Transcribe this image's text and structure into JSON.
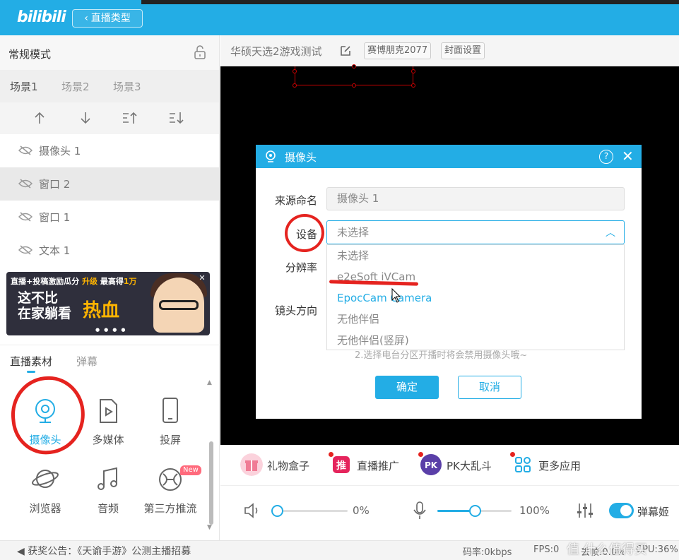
{
  "header": {
    "logo": "bilibili",
    "back_label": "直播类型"
  },
  "left": {
    "mode_label": "常规模式",
    "scenes": [
      "场景1",
      "场景2",
      "场景3"
    ],
    "sources": [
      {
        "label": "摄像头 1",
        "selected": false
      },
      {
        "label": "窗口 2",
        "selected": true
      },
      {
        "label": "窗口 1",
        "selected": false
      },
      {
        "label": "文本 1",
        "selected": false
      }
    ],
    "banner": {
      "line1": "直播+投稿激励瓜分",
      "line2a": "这不比",
      "line2b": "在家躺看",
      "highlight": "热血",
      "upgrade": "升级",
      "max": "最高得",
      "amount": "1万"
    },
    "material_tabs": [
      "直播素材",
      "弹幕"
    ],
    "tiles": [
      {
        "label": "摄像头",
        "icon": "camera-icon",
        "active": true
      },
      {
        "label": "多媒体",
        "icon": "media-file-icon",
        "active": false
      },
      {
        "label": "投屏",
        "icon": "phone-icon",
        "active": false
      },
      {
        "label": "浏览器",
        "icon": "planet-icon",
        "active": false
      },
      {
        "label": "音频",
        "icon": "music-note-icon",
        "active": false
      },
      {
        "label": "第三方推流",
        "icon": "stream-icon",
        "active": false,
        "badge": "New"
      }
    ]
  },
  "room": {
    "title": "华硕天选2游戏测试",
    "category": "赛博朋克2077",
    "cover_button": "封面设置"
  },
  "dialog": {
    "title": "摄像头",
    "help": "?",
    "source_name_label": "来源命名",
    "source_name_value": "摄像头 1",
    "device_label": "设备",
    "device_value": "未选择",
    "resolution_label": "分辨率",
    "direction_label": "镜头方向",
    "options": [
      "未选择",
      "e2eSoft iVCam",
      "EpocCam Camera",
      "无他伴侣",
      "无他伴侣(竖屏)"
    ],
    "tip": "2.选择电台分区开播时将会禁用摄像头哦~",
    "ok": "确定",
    "cancel": "取消"
  },
  "apps": [
    {
      "label": "礼物盒子",
      "color": "#f07c95"
    },
    {
      "label": "直播推广",
      "color": "#e5245c"
    },
    {
      "label": "PK大乱斗",
      "color": "#5a3fa8"
    },
    {
      "label": "更多应用",
      "color": "#23ade5"
    }
  ],
  "controls": {
    "speaker_pct": "0%",
    "speaker_level": 0,
    "mic_pct": "100%",
    "mic_level": 1.0,
    "danmaku_label": "弹幕姬"
  },
  "status": {
    "announcement": "获奖公告：《天谕手游》公测主播招募",
    "bitrate": "码率:0kbps",
    "fps": "FPS:0",
    "drop": "丢帧:0.0%",
    "cpu": "CPU:36%"
  },
  "watermark": "值 什么值得买",
  "colors": {
    "accent": "#23ade5",
    "annotation": "#e5231f"
  }
}
